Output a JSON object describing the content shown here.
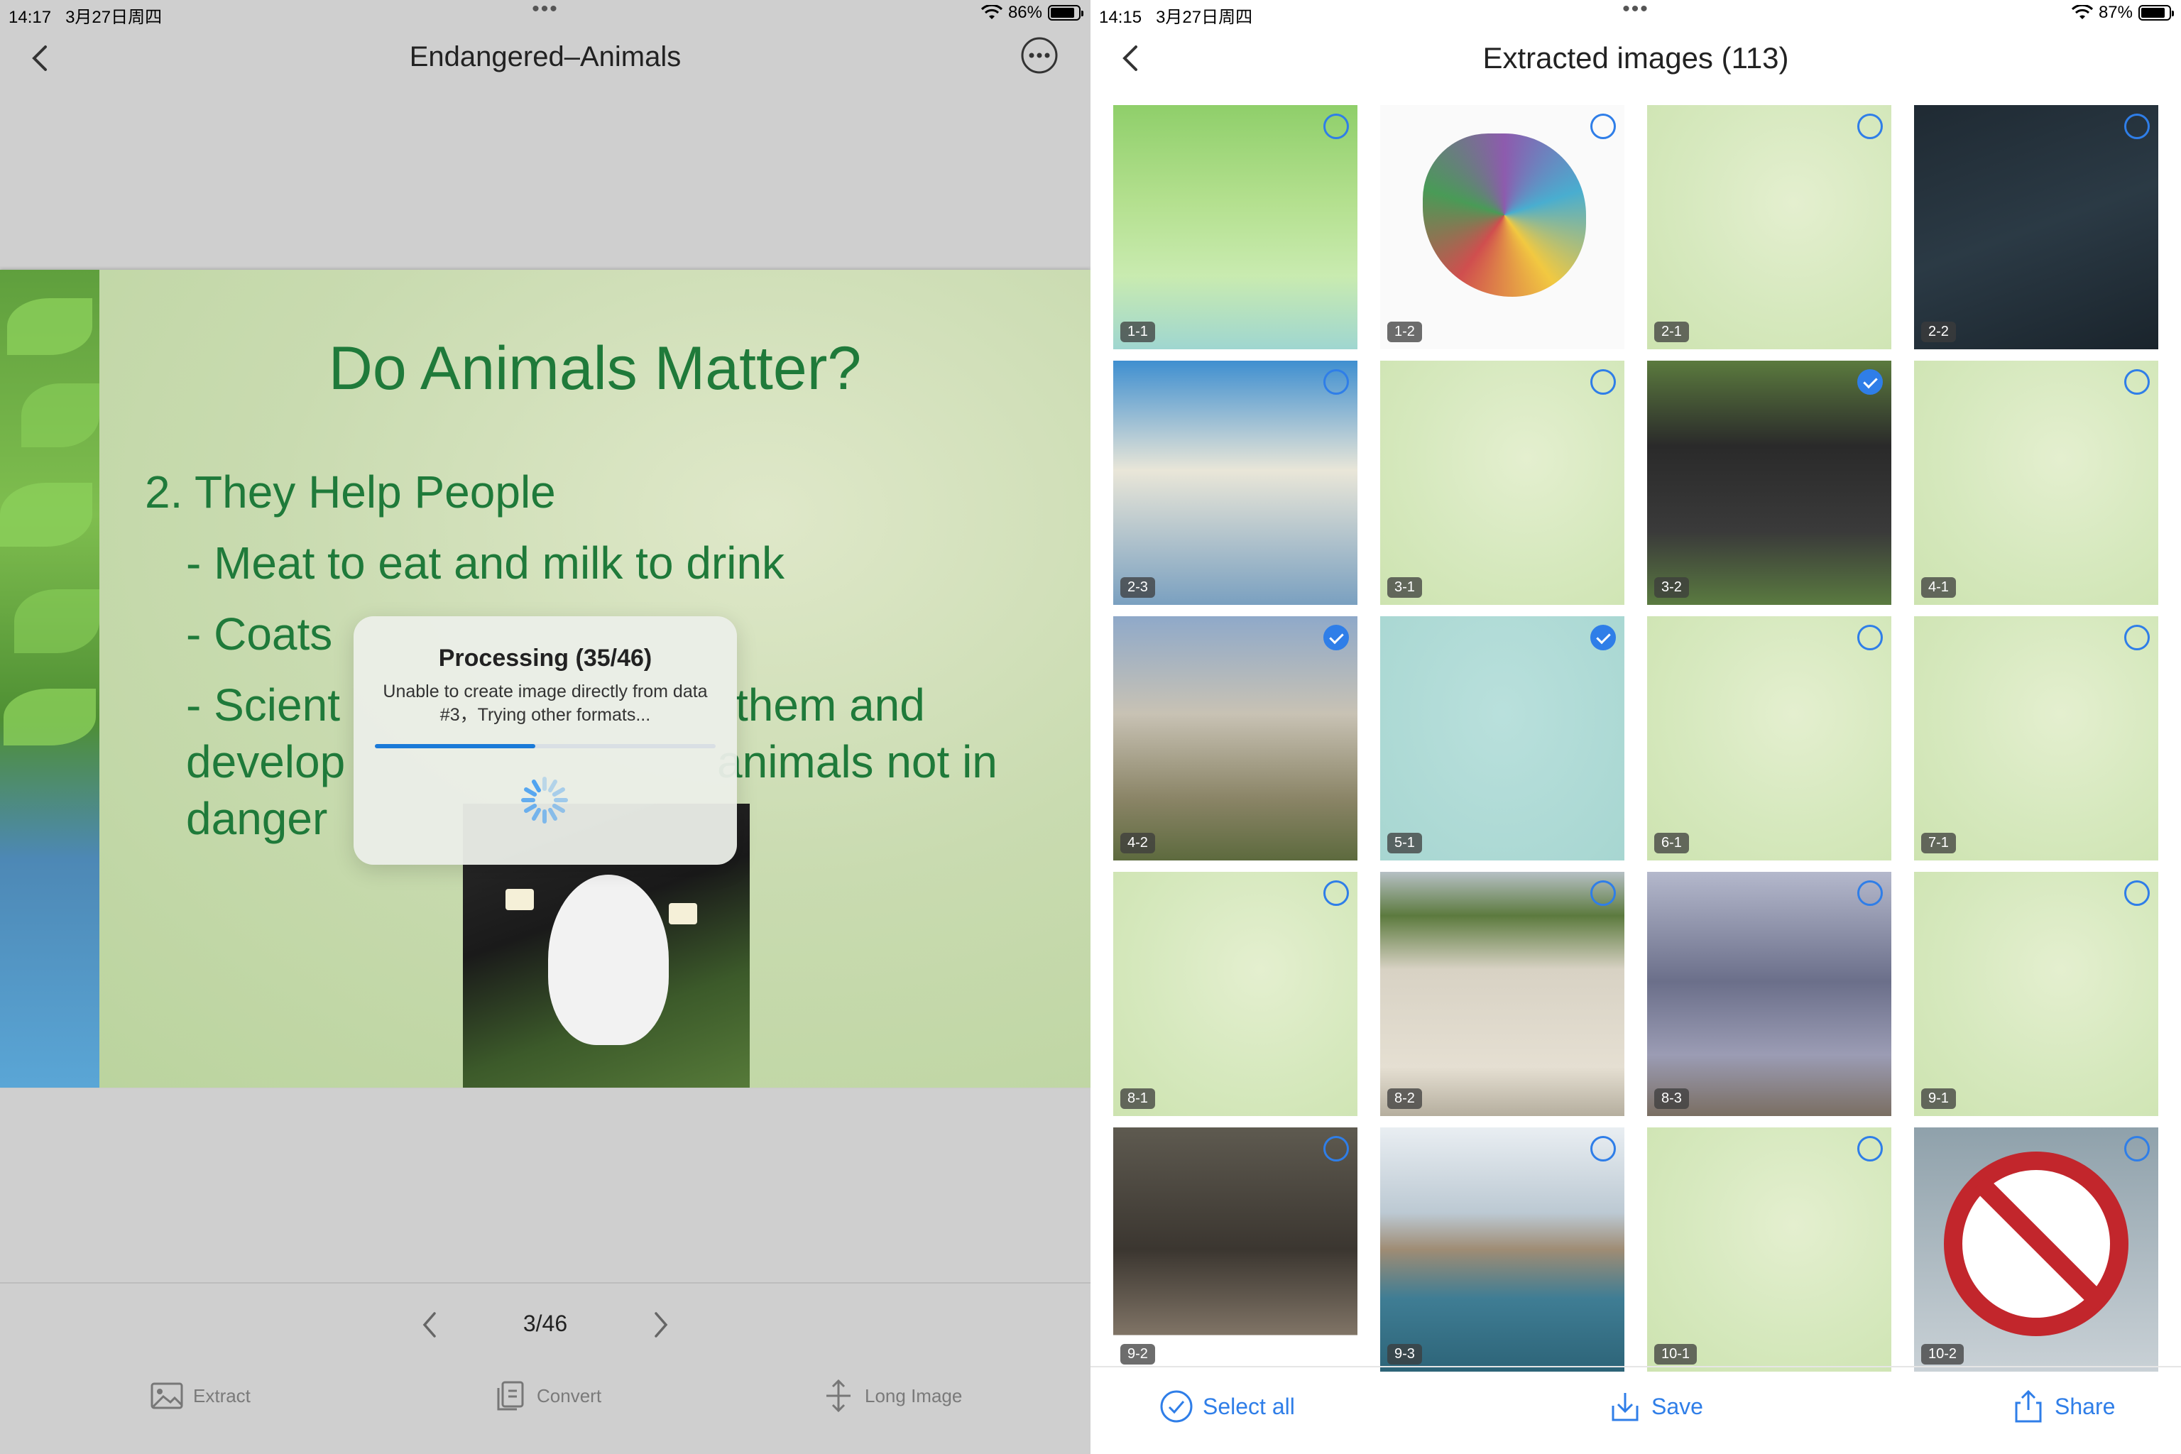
{
  "left": {
    "status": {
      "time": "14:17",
      "date": "3月27日周四",
      "battery": "86%",
      "battery_level": 0.86
    },
    "title": "Endangered–Animals",
    "slide": {
      "title": "Do Animals Matter?",
      "line1": "2. They Help People",
      "line2": "- Meat to eat and milk to drink",
      "line3": "- Coats",
      "line4a": "- Scient",
      "line4b": "them and",
      "line5a": "develop",
      "line5b": "animals not in",
      "line6": "danger"
    },
    "dialog": {
      "title": "Processing (35/46)",
      "message": "Unable to create image directly from data #3，Trying other formats...",
      "progress": 0.47
    },
    "pager": {
      "count": "3/46"
    },
    "tools": {
      "extract": "Extract",
      "convert": "Convert",
      "long_image": "Long Image"
    }
  },
  "right": {
    "status": {
      "time": "14:15",
      "date": "3月27日周四",
      "battery": "87%",
      "battery_level": 0.87
    },
    "title": "Extracted images (113)",
    "images": [
      {
        "label": "1-1",
        "selected": false
      },
      {
        "label": "1-2",
        "selected": false
      },
      {
        "label": "2-1",
        "selected": false
      },
      {
        "label": "2-2",
        "selected": false
      },
      {
        "label": "2-3",
        "selected": false
      },
      {
        "label": "3-1",
        "selected": false
      },
      {
        "label": "3-2",
        "selected": true
      },
      {
        "label": "4-1",
        "selected": false
      },
      {
        "label": "4-2",
        "selected": true
      },
      {
        "label": "5-1",
        "selected": true
      },
      {
        "label": "6-1",
        "selected": false
      },
      {
        "label": "7-1",
        "selected": false
      },
      {
        "label": "8-1",
        "selected": false
      },
      {
        "label": "8-2",
        "selected": false
      },
      {
        "label": "8-3",
        "selected": false
      },
      {
        "label": "9-1",
        "selected": false
      },
      {
        "label": "9-2",
        "selected": false
      },
      {
        "label": "9-3",
        "selected": false
      },
      {
        "label": "10-1",
        "selected": false
      },
      {
        "label": "10-2",
        "selected": false
      }
    ],
    "bottom": {
      "select_all": "Select all",
      "save": "Save",
      "share": "Share"
    }
  },
  "colors": {
    "accent": "#2f7ee8",
    "slide_text": "#1f7a3a"
  }
}
